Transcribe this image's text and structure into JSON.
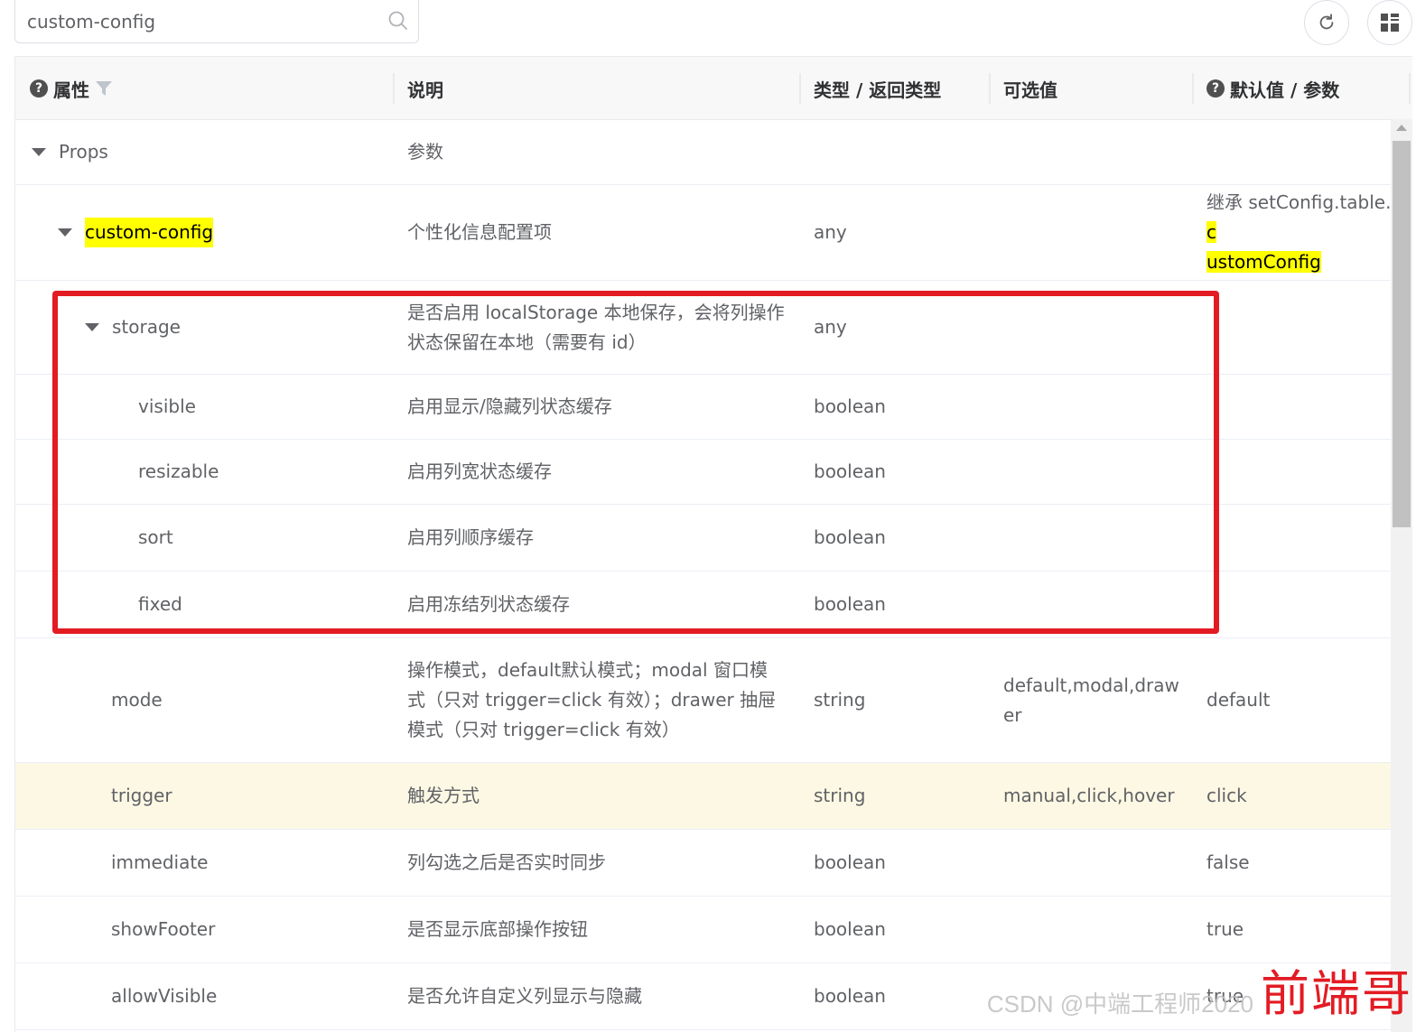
{
  "search": {
    "value": "custom-config"
  },
  "toolbar": {
    "refresh_icon": "refresh-icon",
    "layout_icon": "grid-layout-icon"
  },
  "columns": {
    "attr": "属性",
    "desc": "说明",
    "type": "类型 / 返回类型",
    "options": "可选值",
    "default": "默认值 / 参数"
  },
  "rows": [
    {
      "attr": "Props",
      "desc": "参数",
      "type": "",
      "options": "",
      "default": ""
    },
    {
      "attr": "custom-config",
      "desc": "个性化信息配置项",
      "type": "any",
      "options": "",
      "default_pre": "继承 setConfig.table.",
      "default_mark1": "c",
      "default_mark2": "ustomConfig"
    },
    {
      "attr": "storage",
      "desc": "是否启用 localStorage 本地保存，会将列操作状态保留在本地（需要有 id）",
      "type": "any",
      "options": "",
      "default": ""
    },
    {
      "attr": "visible",
      "desc": "启用显示/隐藏列状态缓存",
      "type": "boolean",
      "options": "",
      "default": ""
    },
    {
      "attr": "resizable",
      "desc": "启用列宽状态缓存",
      "type": "boolean",
      "options": "",
      "default": ""
    },
    {
      "attr": "sort",
      "desc": "启用列顺序缓存",
      "type": "boolean",
      "options": "",
      "default": ""
    },
    {
      "attr": "fixed",
      "desc": "启用冻结列状态缓存",
      "type": "boolean",
      "options": "",
      "default": ""
    },
    {
      "attr": "mode",
      "desc": "操作模式，default默认模式；modal 窗口模式（只对 trigger=click 有效）；drawer 抽屉模式（只对 trigger=click 有效）",
      "type": "string",
      "options": "default,modal,drawer",
      "default": "default"
    },
    {
      "attr": "trigger",
      "desc": "触发方式",
      "type": "string",
      "options": "manual,click,hover",
      "default": "click"
    },
    {
      "attr": "immediate",
      "desc": "列勾选之后是否实时同步",
      "type": "boolean",
      "options": "",
      "default": "false"
    },
    {
      "attr": "showFooter",
      "desc": "是否显示底部操作按钮",
      "type": "boolean",
      "options": "",
      "default": "true"
    },
    {
      "attr": "allowVisible",
      "desc": "是否允许自定义列显示与隐藏",
      "type": "boolean",
      "options": "",
      "default": "true"
    }
  ],
  "watermark": {
    "csdn": "CSDN @中端工程师2020",
    "cn": "前端哥"
  },
  "colors": {
    "highlight_row": "#fdf8e4",
    "mark": "#ffff00",
    "annotation_border": "#e31b23"
  }
}
